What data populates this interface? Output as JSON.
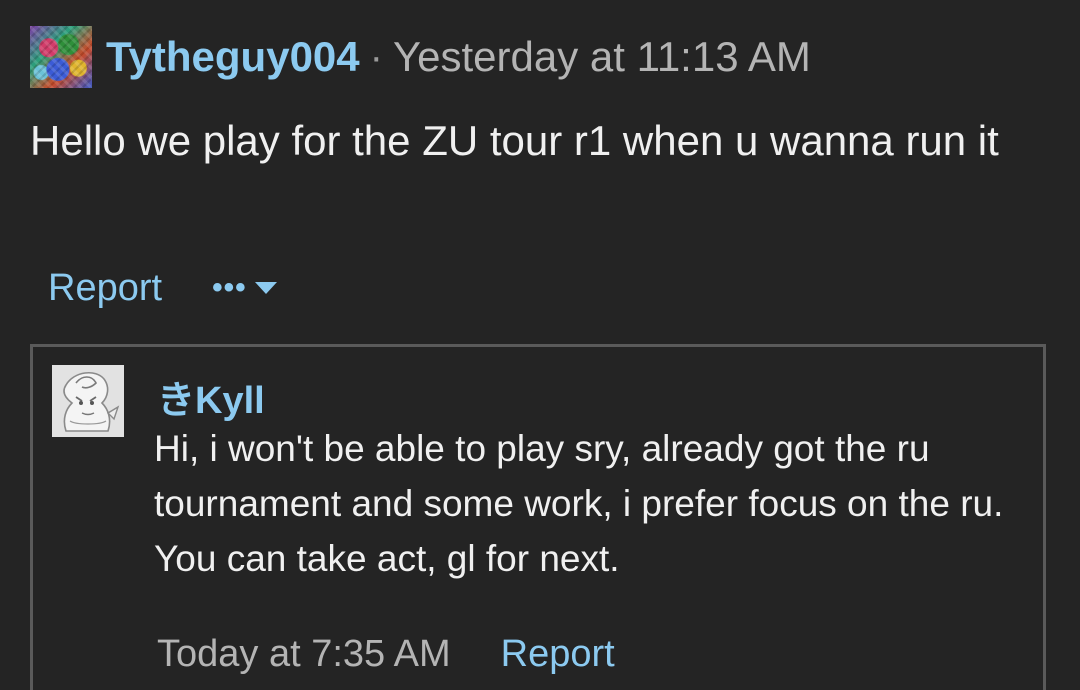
{
  "post": {
    "author": "Tytheguy004",
    "separator": "·",
    "timestamp": "Yesterday at 11:13 AM",
    "body": "Hello we play for the ZU tour r1 when u wanna run it",
    "actions": {
      "report_label": "Report",
      "more_label": "•••"
    }
  },
  "reply": {
    "author": "きKyll",
    "body": "Hi, i won't be able to play sry, already got the ru tournament and some work, i prefer focus on the ru. You can take act, gl for next.",
    "timestamp": "Today at 7:35 AM",
    "report_label": "Report"
  },
  "colors": {
    "background": "#242424",
    "link": "#8ccaf0",
    "text": "#f0f0f0",
    "muted": "#b4b4b4",
    "border": "#5a5a5a"
  },
  "icons": {
    "more_menu": "ellipsis-icon",
    "dropdown": "caret-down-icon"
  }
}
